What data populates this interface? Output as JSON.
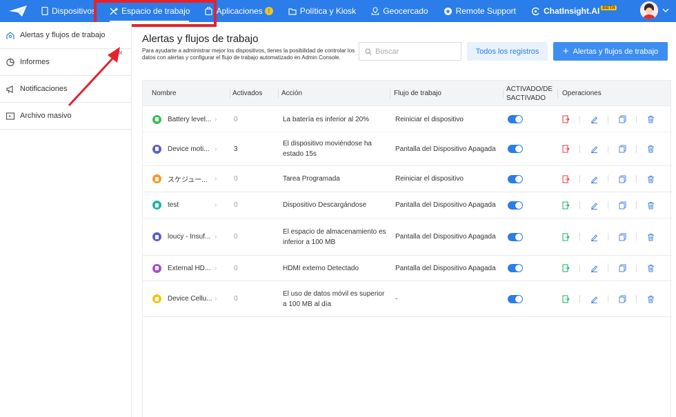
{
  "nav": {
    "items": [
      {
        "label": "Dispositivos",
        "icon": "device-icon"
      },
      {
        "label": "Espacio de trabajo",
        "icon": "tools-icon"
      },
      {
        "label": "Aplicaciones",
        "icon": "app-bag-icon"
      },
      {
        "label": "Política y Kiosk",
        "icon": "folder-icon"
      },
      {
        "label": "Geocercado",
        "icon": "geofence-icon"
      },
      {
        "label": "Remote Support",
        "icon": "lifebuoy-icon"
      },
      {
        "label": "ChatInsight.AI",
        "icon": "chatinsight-icon"
      }
    ],
    "aplicaciones_badge": "!",
    "chatinsight_badge": "BETA"
  },
  "sidebar": {
    "items": [
      {
        "label": "Alertas y flujos de trabajo",
        "icon": "workflow-icon"
      },
      {
        "label": "Informes",
        "icon": "pie-chart-icon"
      },
      {
        "label": "Notificaciones",
        "icon": "megaphone-icon"
      },
      {
        "label": "Archivo masivo",
        "icon": "bulk-file-icon"
      }
    ],
    "collapse_glyph": "«"
  },
  "main": {
    "title": "Alertas y flujos de trabajo",
    "description": "Para ayudarte a administrar mejor los dispositivos, tienes la posibilidad de controlar los datos con alertas y configurar el flujo de trabajo automatizado en Admin Console.",
    "search_placeholder": "Buscar",
    "records_button": "Todos los registros",
    "add_button": "Alertas y flujos de trabajo",
    "add_glyph": "+"
  },
  "table": {
    "headers": {
      "name": "Nombre",
      "activated": "Activados",
      "action": "Acción",
      "workflow": "Flujo de trabajo",
      "status_line1": "ACTIVADO/DE",
      "status_line2": "SACTIVADO",
      "operations": "Operaciones"
    },
    "rows": [
      {
        "name": "Battery level...",
        "count": "0",
        "action_1": "La batería es inferior al 20%",
        "action_2": "",
        "workflow": "Reiniciar el dispositivo",
        "color": "#3bbf5a",
        "enabled": true,
        "op_color": "#e5484d"
      },
      {
        "name": "Device moti...",
        "count": "3",
        "action_1": "El dispositivo moviéndose ha",
        "action_2": "estado 15s",
        "workflow": "Pantalla del Dispositivo Apagada",
        "color": "#5b5fc7",
        "enabled": true,
        "op_color": "#e5484d"
      },
      {
        "name": "スケジュー...",
        "count": "0",
        "action_1": "Tarea Programada",
        "action_2": "",
        "workflow": "Reiniciar el dispositivo",
        "color": "#f59a23",
        "enabled": true,
        "op_color": "#e5484d"
      },
      {
        "name": "test",
        "count": "0",
        "action_1": "Dispositivo Descargándose",
        "action_2": "",
        "workflow": "Pantalla del Dispositivo Apagada",
        "color": "#22b3a6",
        "enabled": true,
        "op_color": "#2bb673"
      },
      {
        "name": "loucy - Insuf...",
        "count": "0",
        "action_1": "El espacio de almacenamiento es",
        "action_2": "inferior a 100 MB",
        "workflow": "Pantalla del Dispositivo Apagada",
        "color": "#5b5fc7",
        "enabled": true,
        "op_color": "#2bb673"
      },
      {
        "name": "External HD...",
        "count": "0",
        "action_1": "HDMI externo Detectado",
        "action_2": "",
        "workflow": "Pantalla del Dispositivo Apagada",
        "color": "#a64fc9",
        "enabled": true,
        "op_color": "#2bb673"
      },
      {
        "name": "Device Cellu...",
        "count": "0",
        "action_1": "El uso de datos móvil es superior",
        "action_2": "a 100 MB al día",
        "workflow": "-",
        "color": "#f5c518",
        "enabled": true,
        "op_color": "#2bb673"
      }
    ]
  },
  "colors": {
    "brand": "#2b7de9",
    "highlight": "#e5222b"
  }
}
